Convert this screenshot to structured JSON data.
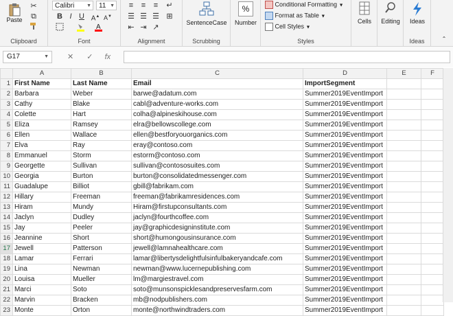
{
  "ribbon": {
    "clipboard": {
      "paste_label": "Paste",
      "group_label": "Clipboard"
    },
    "font": {
      "font_name": "Calibri",
      "font_size": "11",
      "bold": "B",
      "italic": "I",
      "underline": "U",
      "group_label": "Font"
    },
    "alignment": {
      "group_label": "Alignment"
    },
    "scrubbing": {
      "button_label": "SentenceCase",
      "group_label": "Scrubbing"
    },
    "number": {
      "button_label": "Number"
    },
    "styles": {
      "conditional_formatting": "Conditional Formatting",
      "format_as_table": "Format as Table",
      "cell_styles": "Cell Styles",
      "group_label": "Styles"
    },
    "cells": {
      "button_label": "Cells"
    },
    "editing": {
      "button_label": "Editing"
    },
    "ideas": {
      "button_label": "Ideas",
      "group_label": "Ideas"
    }
  },
  "formula_bar": {
    "name_box": "G17",
    "cancel": "✕",
    "enter": "✓",
    "fx": "fx"
  },
  "columns": [
    "A",
    "B",
    "C",
    "D",
    "E",
    "F"
  ],
  "rows": [
    {
      "n": "1",
      "a": "First Name",
      "b": "Last Name",
      "c": "Email",
      "d": "ImportSegment"
    },
    {
      "n": "2",
      "a": "Barbara",
      "b": "Weber",
      "c": "barwe@adatum.com",
      "d": "Summer2019EventImport"
    },
    {
      "n": "3",
      "a": "Cathy",
      "b": "Blake",
      "c": "cabl@adventure-works.com",
      "d": "Summer2019EventImport"
    },
    {
      "n": "4",
      "a": "Colette",
      "b": "Hart",
      "c": "colha@alpineskihouse.com",
      "d": "Summer2019EventImport"
    },
    {
      "n": "5",
      "a": "Eliza",
      "b": "Ramsey",
      "c": "elra@bellowscollege.com",
      "d": "Summer2019EventImport"
    },
    {
      "n": "6",
      "a": "Ellen",
      "b": "Wallace",
      "c": "ellen@bestforyouorganics.com",
      "d": "Summer2019EventImport"
    },
    {
      "n": "7",
      "a": "Elva",
      "b": "Ray",
      "c": "eray@contoso.com",
      "d": "Summer2019EventImport"
    },
    {
      "n": "8",
      "a": "Emmanuel",
      "b": "Storm",
      "c": "estorm@contoso.com",
      "d": "Summer2019EventImport"
    },
    {
      "n": "9",
      "a": "Georgette",
      "b": "Sullivan",
      "c": "sullivan@contososuites.com",
      "d": "Summer2019EventImport"
    },
    {
      "n": "10",
      "a": "Georgia",
      "b": "Burton",
      "c": "burton@consolidatedmessenger.com",
      "d": "Summer2019EventImport"
    },
    {
      "n": "11",
      "a": "Guadalupe",
      "b": "Billiot",
      "c": "gbill@fabrikam.com",
      "d": "Summer2019EventImport"
    },
    {
      "n": "12",
      "a": "Hillary",
      "b": "Freeman",
      "c": "freeman@fabrikamresidences.com",
      "d": "Summer2019EventImport"
    },
    {
      "n": "13",
      "a": "Hiram",
      "b": "Mundy",
      "c": "Hiram@firstupconsultants.com",
      "d": "Summer2019EventImport"
    },
    {
      "n": "14",
      "a": "Jaclyn",
      "b": "Dudley",
      "c": "jaclyn@fourthcoffee.com",
      "d": "Summer2019EventImport"
    },
    {
      "n": "15",
      "a": "Jay",
      "b": "Peeler",
      "c": "jay@graphicdesigninstitute.com",
      "d": "Summer2019EventImport"
    },
    {
      "n": "16",
      "a": "Jeannine",
      "b": "Short",
      "c": "short@humongousinsurance.com",
      "d": "Summer2019EventImport"
    },
    {
      "n": "17",
      "a": "Jewell",
      "b": "Patterson",
      "c": "jewell@lamnahealthcare.com",
      "d": "Summer2019EventImport"
    },
    {
      "n": "18",
      "a": "Lamar",
      "b": "Ferrari",
      "c": "lamar@libertysdelightfulsinfulbakeryandcafe.com",
      "d": "Summer2019EventImport"
    },
    {
      "n": "19",
      "a": "Lina",
      "b": "Newman",
      "c": "newman@www.lucernepublishing.com",
      "d": "Summer2019EventImport"
    },
    {
      "n": "20",
      "a": "Louisa",
      "b": "Mueller",
      "c": "lm@margiestravel.com",
      "d": "Summer2019EventImport"
    },
    {
      "n": "21",
      "a": "Marci",
      "b": "Soto",
      "c": "soto@munsonspicklesandpreservesfarm.com",
      "d": "Summer2019EventImport"
    },
    {
      "n": "22",
      "a": "Marvin",
      "b": "Bracken",
      "c": "mb@nodpublishers.com",
      "d": "Summer2019EventImport"
    },
    {
      "n": "23",
      "a": "Monte",
      "b": "Orton",
      "c": "monte@northwindtraders.com",
      "d": "Summer2019EventImport"
    }
  ],
  "colors": {
    "font_color": "#ff0000",
    "fill_color": "#ffff00",
    "ideas_icon": "#2b7cd3",
    "active_row_text": "#217346"
  },
  "icons": [
    "paste-icon",
    "cut-icon",
    "copy-icon",
    "format-painter-icon",
    "fill-color-icon",
    "font-color-icon",
    "flowchart-icon",
    "percent-icon",
    "table-icon",
    "search-icon",
    "lightning-icon"
  ]
}
